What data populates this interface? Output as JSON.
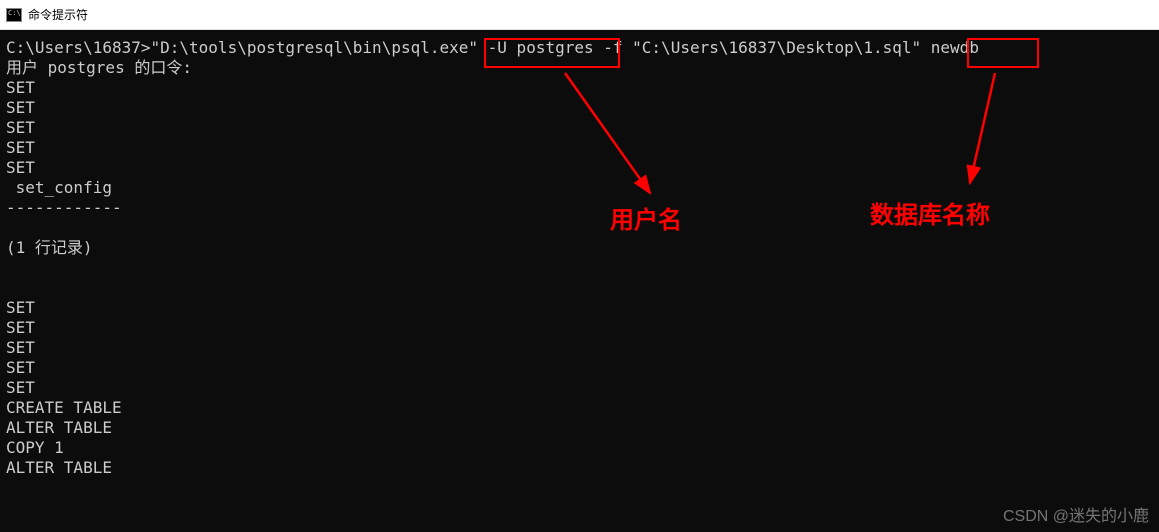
{
  "titlebar": {
    "title": "命令提示符"
  },
  "terminal": {
    "prompt": "C:\\Users\\16837>",
    "cmd_part1": "\"D:\\tools\\postgresql\\bin\\psql.exe\" ",
    "cmd_highlight1": "-U postgres",
    "cmd_part2": " -f \"C:\\Users\\16837\\Desktop\\1.sql\" ",
    "cmd_highlight2": "newdb",
    "line2": "用户 postgres 的口令:",
    "outputs": [
      "SET",
      "SET",
      "SET",
      "SET",
      "SET",
      " set_config",
      "------------",
      "",
      "(1 行记录)",
      "",
      "",
      "SET",
      "SET",
      "SET",
      "SET",
      "SET",
      "CREATE TABLE",
      "ALTER TABLE",
      "COPY 1",
      "ALTER TABLE"
    ]
  },
  "annotations": {
    "label1": "用户名",
    "label2": "数据库名称"
  },
  "watermark": "CSDN @迷失的小鹿"
}
